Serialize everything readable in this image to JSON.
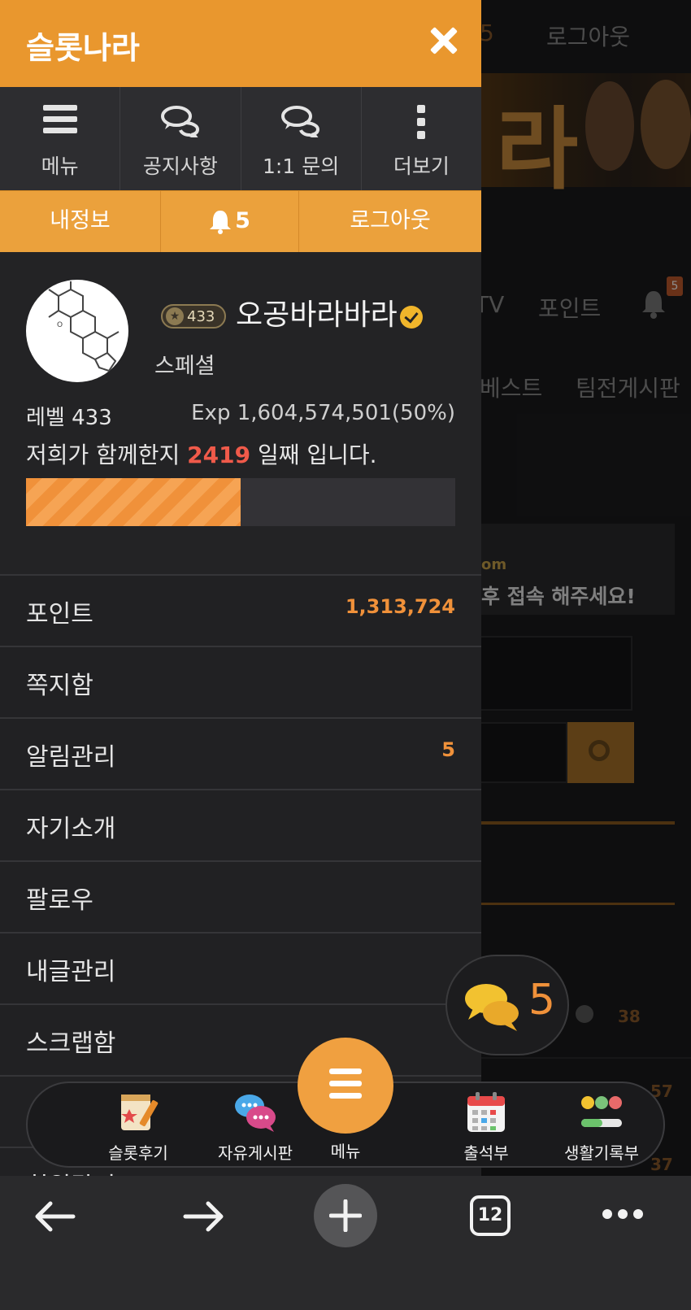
{
  "background": {
    "logout": "로그아웃",
    "nav_tv": "TV",
    "nav_point": "포인트",
    "bell_badge": "5",
    "nav_best": "베스트",
    "nav_team_board": "팀전게시판",
    "notice_line1": "om",
    "notice_line2": "후 접속 해주세요!",
    "comment_count_1": "38",
    "comment_count_2": "57",
    "comment_count_3": "37"
  },
  "drawer": {
    "title": "슬롯나라",
    "nav": [
      {
        "label": "메뉴",
        "icon": "hamburger-icon"
      },
      {
        "label": "공지사항",
        "icon": "speech-bubbles-icon"
      },
      {
        "label": "1:1 문의",
        "icon": "speech-bubbles-icon"
      },
      {
        "label": "더보기",
        "icon": "vertical-dots-icon"
      }
    ],
    "quick": {
      "my_info": "내정보",
      "notifications": "5",
      "logout": "로그아웃"
    },
    "profile": {
      "level_badge": "433",
      "nickname": "오공바라바라",
      "grade": "스페셜",
      "level": "레벨 433",
      "exp": "Exp 1,604,574,501(50%)",
      "days_prefix": "저희가 함께한지 ",
      "days": "2419",
      "days_suffix": " 일째 입니다.",
      "exp_progress": 0.5
    },
    "menu": [
      {
        "label": "포인트",
        "value": "1,313,724"
      },
      {
        "label": "쪽지함",
        "value": ""
      },
      {
        "label": "알림관리",
        "value": "5"
      },
      {
        "label": "자기소개",
        "value": ""
      },
      {
        "label": "팔로우",
        "value": ""
      },
      {
        "label": "내글관리",
        "value": ""
      },
      {
        "label": "스크랩함",
        "value": ""
      },
      {
        "label": "",
        "value": ""
      },
      {
        "label": "회원탈퇴",
        "value": ""
      }
    ]
  },
  "chat_pill": {
    "count": "5"
  },
  "tabbar": {
    "items": [
      {
        "label": "슬롯후기",
        "icon": "review-note-icon"
      },
      {
        "label": "자유게시판",
        "icon": "chat-bubbles-icon"
      },
      {
        "label": "메뉴",
        "icon": "hamburger-icon"
      },
      {
        "label": "출석부",
        "icon": "calendar-icon"
      },
      {
        "label": "생활기록부",
        "icon": "mood-faces-icon"
      }
    ]
  },
  "browser": {
    "tab_count": "12",
    "buttons": [
      "back-arrow-icon",
      "forward-arrow-icon",
      "new-tab-plus-icon",
      "tab-count-icon",
      "more-dots-icon"
    ]
  },
  "colors": {
    "accent": "#e9972e",
    "highlight_red": "#f05a4a",
    "value_orange": "#f0913a"
  }
}
